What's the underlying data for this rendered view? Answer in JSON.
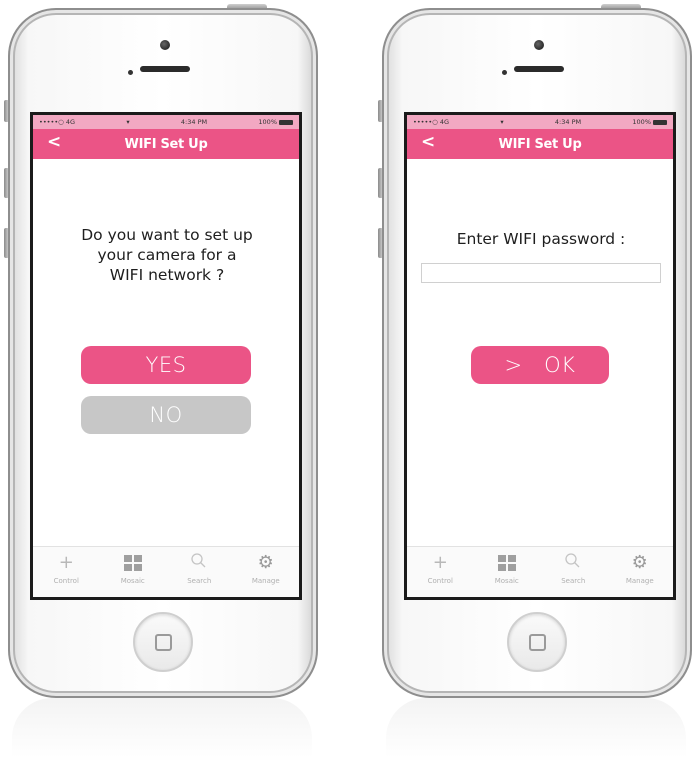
{
  "screens": [
    {
      "status": {
        "carrier": "•••••○ 4G",
        "wifi": "▾",
        "time": "4:34 PM",
        "battery": "100%"
      },
      "nav": {
        "back": "<",
        "title": "WIFI Set Up"
      },
      "question": "Do you want to set up\nyour camera for a\nWIFI network ?",
      "yes_label": "YES",
      "no_label": "NO"
    },
    {
      "status": {
        "carrier": "•••••○ 4G",
        "wifi": "▾",
        "time": "4:34 PM",
        "battery": "100%"
      },
      "nav": {
        "back": "<",
        "title": "WIFI Set Up"
      },
      "prompt": "Enter WIFI password :",
      "password_value": "",
      "ok_label": ">   OK"
    }
  ],
  "tabs": [
    {
      "label": "Control",
      "icon": "plus-icon"
    },
    {
      "label": "Mosaic",
      "icon": "grid-icon"
    },
    {
      "label": "Search",
      "icon": "search-icon"
    },
    {
      "label": "Manage",
      "icon": "gear-icon"
    }
  ],
  "colors": {
    "accent": "#eb5486",
    "status_bar": "#f2a8c2",
    "disabled": "#c7c7c7"
  }
}
